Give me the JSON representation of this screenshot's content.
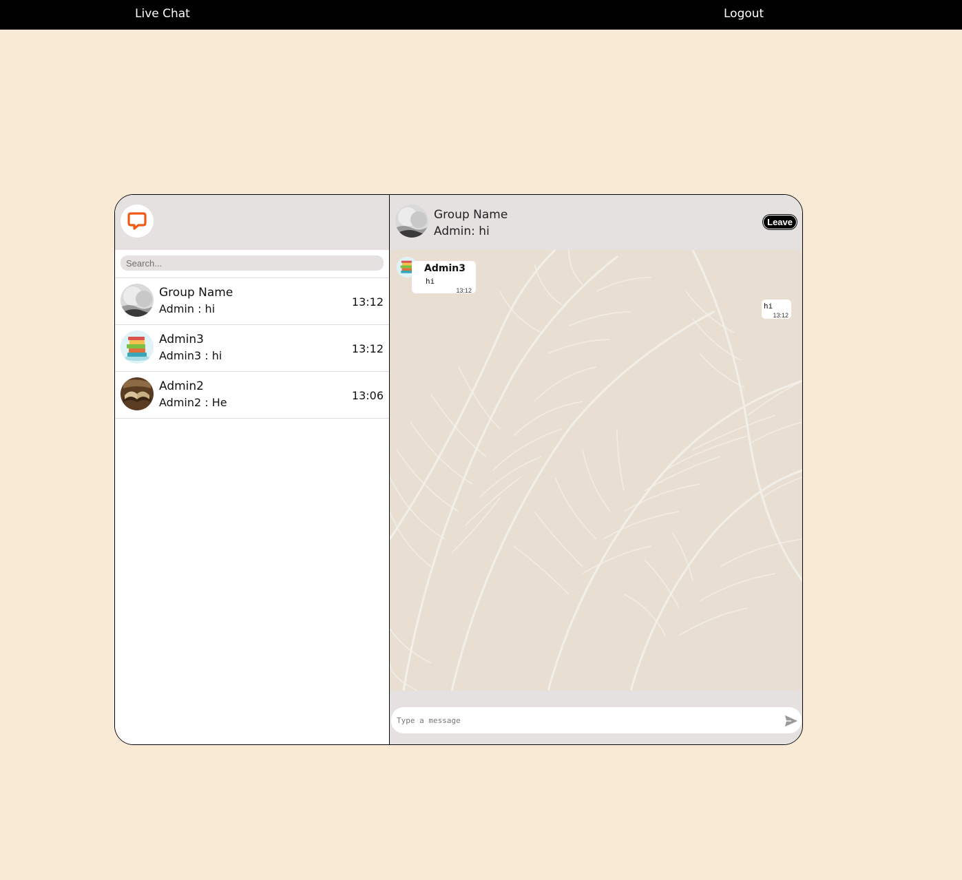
{
  "topbar": {
    "brand": "Live Chat",
    "logout": "Logout"
  },
  "sidebar": {
    "logo_icon": "chat-bubble-logo",
    "search_placeholder": "Search...",
    "chats": [
      {
        "name": "Group Name",
        "preview": "Admin : hi",
        "time": "13:12",
        "avatar": "snowy-landscape-avatar"
      },
      {
        "name": "Admin3",
        "preview": "Admin3 : hi",
        "time": "13:12",
        "avatar": "books-stack-avatar"
      },
      {
        "name": "Admin2",
        "preview": "Admin2 : He",
        "time": "13:06",
        "avatar": "open-book-avatar"
      }
    ]
  },
  "conversation": {
    "title": "Group Name",
    "subtitle": "Admin: hi",
    "leave_label": "Leave",
    "messages": [
      {
        "direction": "incoming",
        "sender": "Admin3",
        "text": "hi",
        "time": "13:12"
      },
      {
        "direction": "outgoing",
        "text": "hi",
        "time": "13:12"
      }
    ],
    "input_placeholder": "Type a message",
    "send_icon": "send-icon"
  },
  "colors": {
    "page_bg": "#f9ead6",
    "topbar_bg": "#000000",
    "panel_header_bg": "#e5e1e0",
    "chat_wallpaper": "#e8dfd2",
    "logo_accent": "#f05a14"
  }
}
